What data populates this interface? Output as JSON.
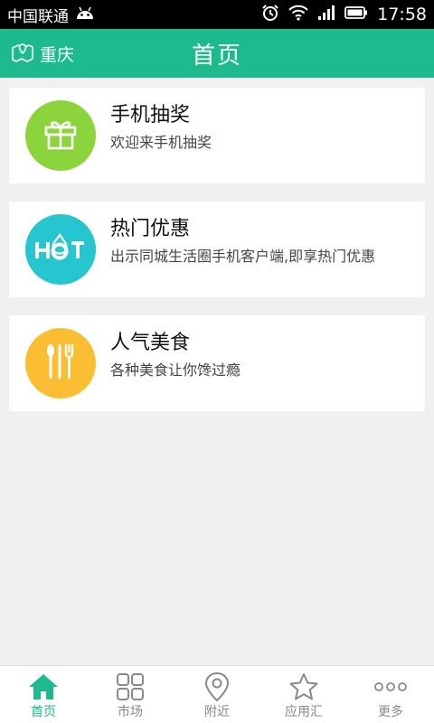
{
  "status_bar": {
    "carrier": "中国联通",
    "time": "17:58"
  },
  "header": {
    "location": "重庆",
    "title": "首页"
  },
  "cards": [
    {
      "title": "手机抽奖",
      "desc": "欢迎来手机抽奖",
      "icon": "gift-icon",
      "color": "#8cd43c"
    },
    {
      "title": "热门优惠",
      "desc": "出示同城生活圈手机客户端,即享热门优惠",
      "icon": "hot-icon",
      "color": "#26c6d0"
    },
    {
      "title": "人气美食",
      "desc": "各种美食让你馋过瘾",
      "icon": "cutlery-icon",
      "color": "#fbbd32"
    }
  ],
  "bottom_nav": [
    {
      "label": "首页",
      "icon": "home-icon",
      "active": true
    },
    {
      "label": "市场",
      "icon": "grid-icon",
      "active": false
    },
    {
      "label": "附近",
      "icon": "location-pin-icon",
      "active": false
    },
    {
      "label": "应用汇",
      "icon": "star-icon",
      "active": false
    },
    {
      "label": "更多",
      "icon": "more-icon",
      "active": false
    }
  ],
  "colors": {
    "accent": "#1cba8c",
    "status_bar": "#000000",
    "background": "#f0f0f0"
  }
}
